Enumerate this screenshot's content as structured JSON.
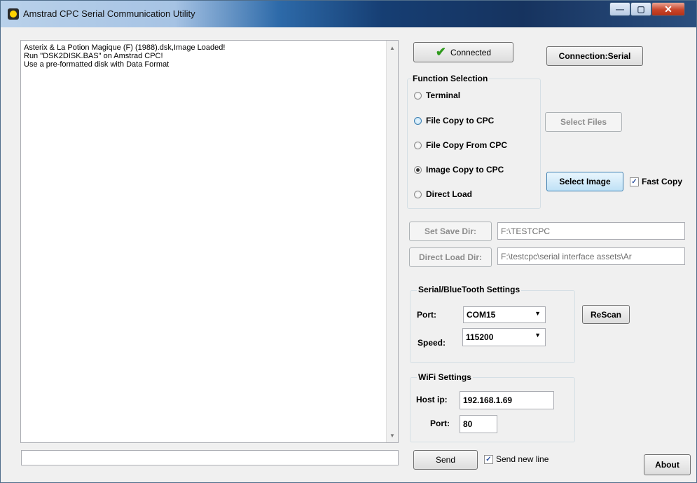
{
  "window": {
    "title": "Amstrad CPC Serial Communication Utility",
    "controls": {
      "minimize": "—",
      "maximize": "▢",
      "close": "✕"
    }
  },
  "log": {
    "lines": [
      "Asterix & La Potion Magique (F) (1988).dsk,Image Loaded!",
      "Run \"DSK2DISK.BAS\" on Amstrad CPC!",
      "Use a pre-formatted disk with Data Format"
    ]
  },
  "send": {
    "input_value": "",
    "button_label": "Send",
    "newline_label": "Send new line",
    "newline_checked": true
  },
  "status": {
    "connected_label": "Connected",
    "connection_label": "Connection:Serial"
  },
  "function_selection": {
    "title": "Function Selection",
    "options": [
      {
        "label": "Terminal",
        "checked": false
      },
      {
        "label": "File Copy to CPC",
        "checked": false
      },
      {
        "label": "File Copy From CPC",
        "checked": false
      },
      {
        "label": "Image Copy to CPC",
        "checked": true
      },
      {
        "label": "Direct Load",
        "checked": false
      }
    ]
  },
  "actions": {
    "select_files": "Select  Files",
    "select_image": "Select Image",
    "fast_copy_label": "Fast Copy",
    "fast_copy_checked": true
  },
  "dirs": {
    "save_dir_button": "Set Save Dir:",
    "save_dir_value": "F:\\TESTCPC",
    "direct_load_button": "Direct Load Dir:",
    "direct_load_value": "F:\\testcpc\\serial interface assets\\Ar"
  },
  "serial": {
    "title": "Serial/BlueTooth Settings",
    "port_label": "Port:",
    "port_value": "COM15",
    "speed_label": "Speed:",
    "speed_value": "115200",
    "rescan_button": "ReScan"
  },
  "wifi": {
    "title": "WiFi Settings",
    "host_label": "Host ip:",
    "host_value": "192.168.1.69",
    "port_label": "Port:",
    "port_value": "80"
  },
  "about_button": "About"
}
